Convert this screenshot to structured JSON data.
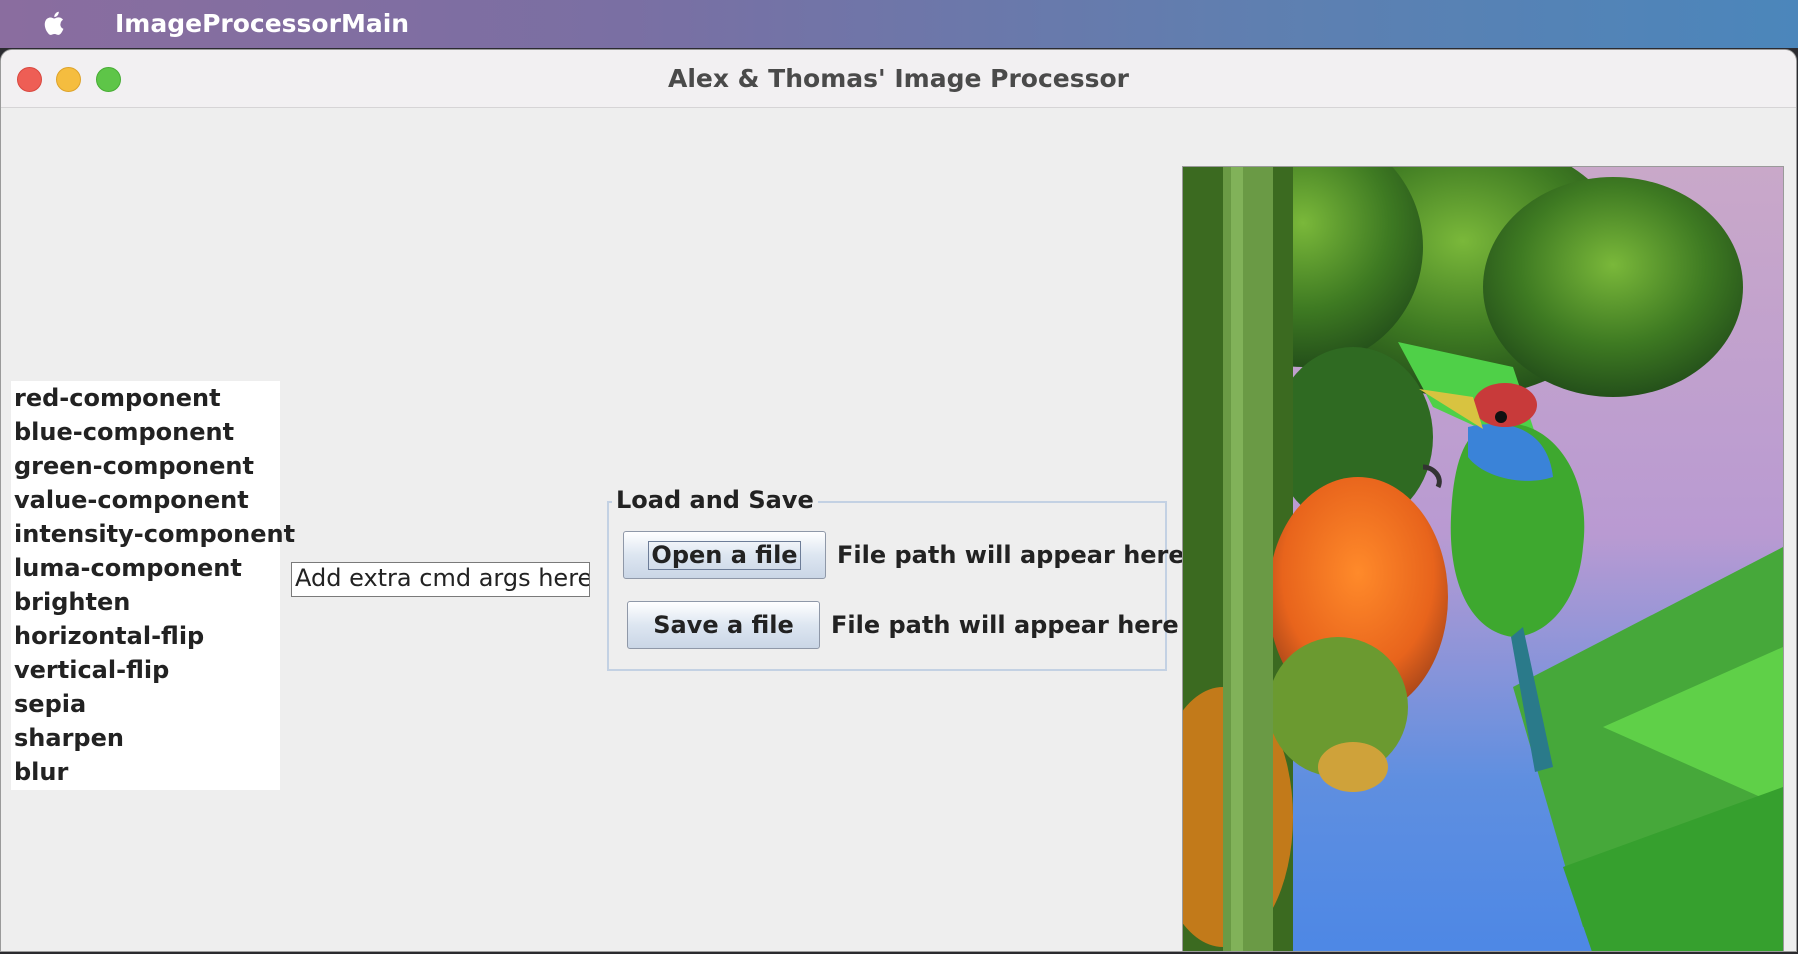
{
  "menubar": {
    "apple_icon": "apple-logo-icon",
    "app_name": "ImageProcessorMain"
  },
  "window": {
    "title": "Alex & Thomas' Image Processor",
    "controls": [
      "close",
      "minimize",
      "zoom"
    ]
  },
  "operations": {
    "items": [
      "red-component",
      "blue-component",
      "green-component",
      "value-component",
      "intensity-component",
      "luma-component",
      "brighten",
      "horizontal-flip",
      "vertical-flip",
      "sepia",
      "sharpen",
      "blur"
    ]
  },
  "args_input": {
    "value": "Add extra cmd args here"
  },
  "load_save": {
    "legend": "Load and Save",
    "open_button": "Open a file",
    "open_path": "File path will appear here",
    "save_button": "Save a file",
    "save_path": "File path will appear here"
  },
  "preview": {
    "description_icon": "bird-photo"
  }
}
